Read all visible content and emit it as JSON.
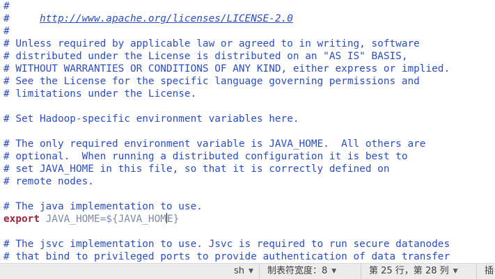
{
  "editor": {
    "lines": {
      "l1": "#",
      "l2_prefix": "#     ",
      "l2_url": "http://www.apache.org/licenses/LICENSE-2.0",
      "l3": "#",
      "l4": "# Unless required by applicable law or agreed to in writing, software",
      "l5": "# distributed under the License is distributed on an \"AS IS\" BASIS,",
      "l6": "# WITHOUT WARRANTIES OR CONDITIONS OF ANY KIND, either express or implied.",
      "l7": "# See the License for the specific language governing permissions and",
      "l8": "# limitations under the License.",
      "l10": "# Set Hadoop-specific environment variables here.",
      "l12": "# The only required environment variable is JAVA_HOME.  All others are",
      "l13": "# optional.  When running a distributed configuration it is best to",
      "l14": "# set JAVA_HOME in this file, so that it is correctly defined on",
      "l15": "# remote nodes.",
      "l17": "# The java implementation to use.",
      "l18_keyword": "export",
      "l18_before_cursor": " JAVA_HOME=${JAVA_HOM",
      "l18_after_cursor": "E}",
      "l20": "# The jsvc implementation to use. Jsvc is required to run secure datanodes",
      "l21": "# that bind to privileged ports to provide authentication of data transfer"
    }
  },
  "statusbar": {
    "language": "sh",
    "tab_width": "制表符宽度：8",
    "position": "第 25 行，第 28 列",
    "insert_mode": "插"
  },
  "colors": {
    "comment": "#2a4cc6",
    "keyword": "#a3213a",
    "variable": "#7a8aa8",
    "statusbar_bg": "#ececec"
  }
}
